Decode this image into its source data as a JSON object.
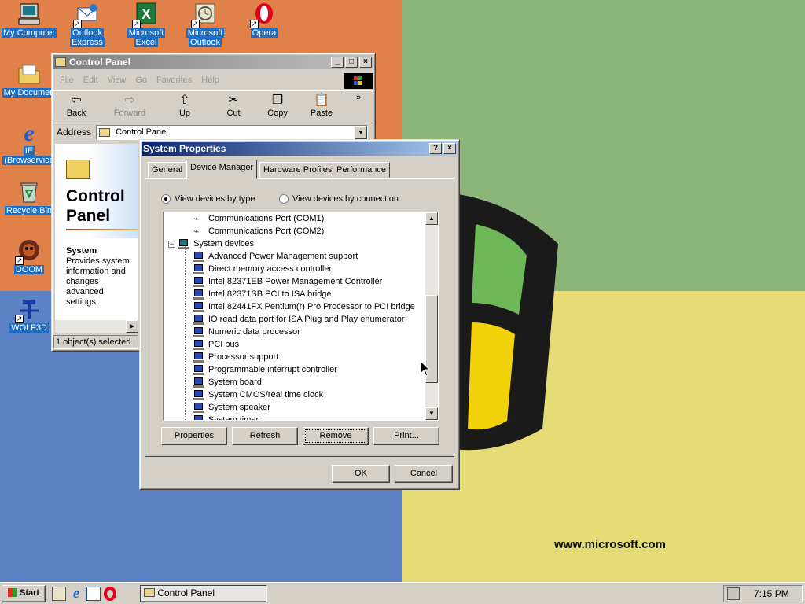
{
  "desktop": {
    "icons": [
      {
        "label1": "My Computer",
        "label2": ""
      },
      {
        "label1": "Outlook",
        "label2": "Express"
      },
      {
        "label1": "Microsoft",
        "label2": "Excel"
      },
      {
        "label1": "Microsoft",
        "label2": "Outlook"
      },
      {
        "label1": "Opera",
        "label2": ""
      },
      {
        "label1": "My Documen",
        "label2": ""
      },
      {
        "label1": "IE",
        "label2": "(Browservice"
      },
      {
        "label1": "Recycle Bin",
        "label2": ""
      },
      {
        "label1": "DOOM",
        "label2": ""
      },
      {
        "label1": "WOLF3D",
        "label2": ""
      }
    ],
    "wallpaper_url": "www.microsoft.com"
  },
  "control_panel": {
    "title": "Control Panel",
    "menu": [
      "File",
      "Edit",
      "View",
      "Go",
      "Favorites",
      "Help"
    ],
    "toolbar": {
      "back": "Back",
      "forward": "Forward",
      "up": "Up",
      "cut": "Cut",
      "copy": "Copy",
      "paste": "Paste",
      "more": "»"
    },
    "address_label": "Address",
    "address_value": "Control Panel",
    "heading_line1": "Control",
    "heading_line2": "Panel",
    "info_title": "System",
    "info_text": "Provides system information and changes advanced settings.",
    "status": "1 object(s) selected"
  },
  "system_properties": {
    "title": "System Properties",
    "help_btn": "?",
    "close_btn": "×",
    "tabs": [
      "General",
      "Device Manager",
      "Hardware Profiles",
      "Performance"
    ],
    "radio_type": "View devices by type",
    "radio_connection": "View devices by connection",
    "selected_view": "type",
    "devices": [
      {
        "label": "Communications Port (COM1)",
        "icon": "port-icon",
        "indent": 2
      },
      {
        "label": "Communications Port (COM2)",
        "icon": "port-icon",
        "indent": 2
      },
      {
        "label": "System devices",
        "icon": "computer-icon",
        "indent": 1,
        "expander": "−"
      },
      {
        "label": "Advanced Power Management support",
        "icon": "device-chip-icon",
        "indent": 2
      },
      {
        "label": "Direct memory access controller",
        "icon": "device-chip-icon",
        "indent": 2
      },
      {
        "label": "Intel 82371EB Power Management Controller",
        "icon": "device-chip-icon",
        "indent": 2
      },
      {
        "label": "Intel 82371SB PCI to ISA bridge",
        "icon": "device-chip-icon",
        "indent": 2
      },
      {
        "label": "Intel 82441FX Pentium(r) Pro Processor to PCI bridge",
        "icon": "device-chip-icon",
        "indent": 2
      },
      {
        "label": "IO read data port for ISA Plug and Play enumerator",
        "icon": "device-chip-icon",
        "indent": 2
      },
      {
        "label": "Numeric data processor",
        "icon": "device-chip-icon",
        "indent": 2
      },
      {
        "label": "PCI bus",
        "icon": "device-chip-icon",
        "indent": 2
      },
      {
        "label": "Processor support",
        "icon": "device-chip-icon",
        "indent": 2
      },
      {
        "label": "Programmable interrupt controller",
        "icon": "device-chip-icon",
        "indent": 2
      },
      {
        "label": "System board",
        "icon": "device-chip-icon",
        "indent": 2
      },
      {
        "label": "System CMOS/real time clock",
        "icon": "device-chip-icon",
        "indent": 2
      },
      {
        "label": "System speaker",
        "icon": "device-chip-icon",
        "indent": 2
      },
      {
        "label": "System timer",
        "icon": "device-chip-icon",
        "indent": 2
      }
    ],
    "buttons": {
      "properties": "Properties",
      "refresh": "Refresh",
      "remove": "Remove",
      "print": "Print..."
    },
    "ok": "OK",
    "cancel": "Cancel"
  },
  "taskbar": {
    "start": "Start",
    "task": "Control Panel",
    "clock": "7:15 PM"
  },
  "colors": {
    "title_active": "#0a246a",
    "label_bg": "#1c6fc7",
    "face": "#d4d0c8"
  }
}
